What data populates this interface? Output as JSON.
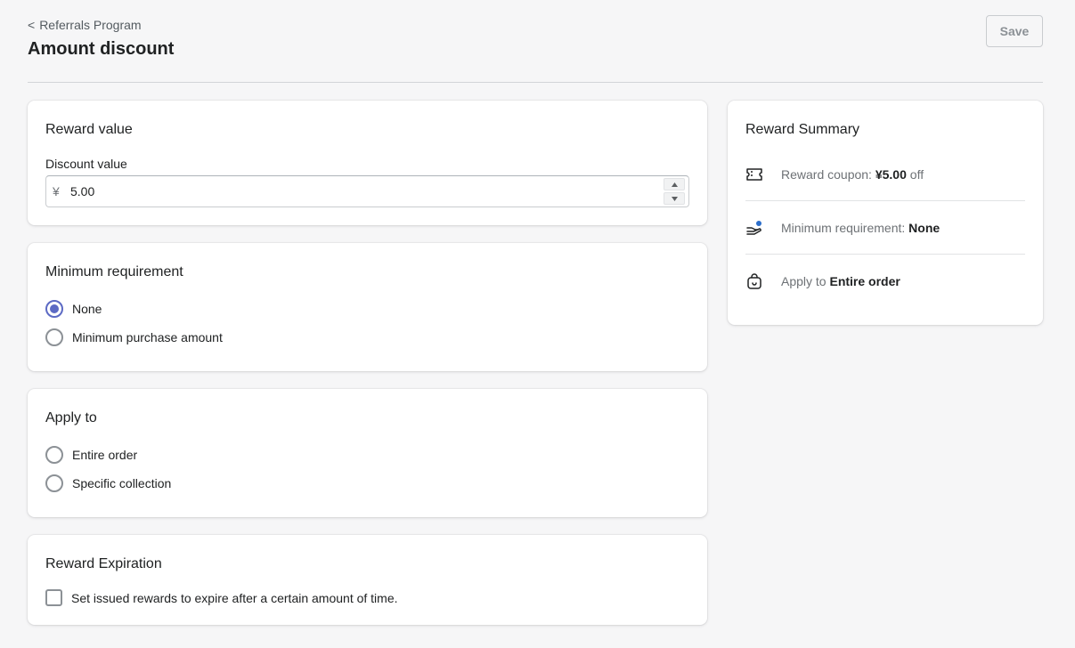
{
  "header": {
    "back_label": "Referrals Program",
    "title": "Amount discount",
    "save_label": "Save"
  },
  "reward_value": {
    "title": "Reward value",
    "field_label": "Discount value",
    "currency_prefix": "¥",
    "value": "5.00"
  },
  "minimum_requirement": {
    "title": "Minimum requirement",
    "options": [
      {
        "label": "None",
        "checked": true
      },
      {
        "label": "Minimum purchase amount",
        "checked": false
      }
    ]
  },
  "apply_to": {
    "title": "Apply to",
    "options": [
      {
        "label": "Entire order",
        "checked": false
      },
      {
        "label": "Specific collection",
        "checked": false
      }
    ]
  },
  "expiration": {
    "title": "Reward Expiration",
    "checkbox_label": "Set issued rewards to expire after a certain amount of time."
  },
  "summary": {
    "title": "Reward Summary",
    "items": [
      {
        "prefix": "Reward coupon:",
        "value": "¥5.00",
        "suffix": "off",
        "icon": "ticket-icon"
      },
      {
        "prefix": "Minimum requirement:",
        "value": "None",
        "suffix": "",
        "icon": "hand-coin-icon"
      },
      {
        "prefix": "Apply to",
        "value": "Entire order",
        "suffix": "",
        "icon": "bag-icon"
      }
    ]
  },
  "colors": {
    "accent": "#5c6ac4",
    "icon_dot": "#2c6ecb"
  }
}
